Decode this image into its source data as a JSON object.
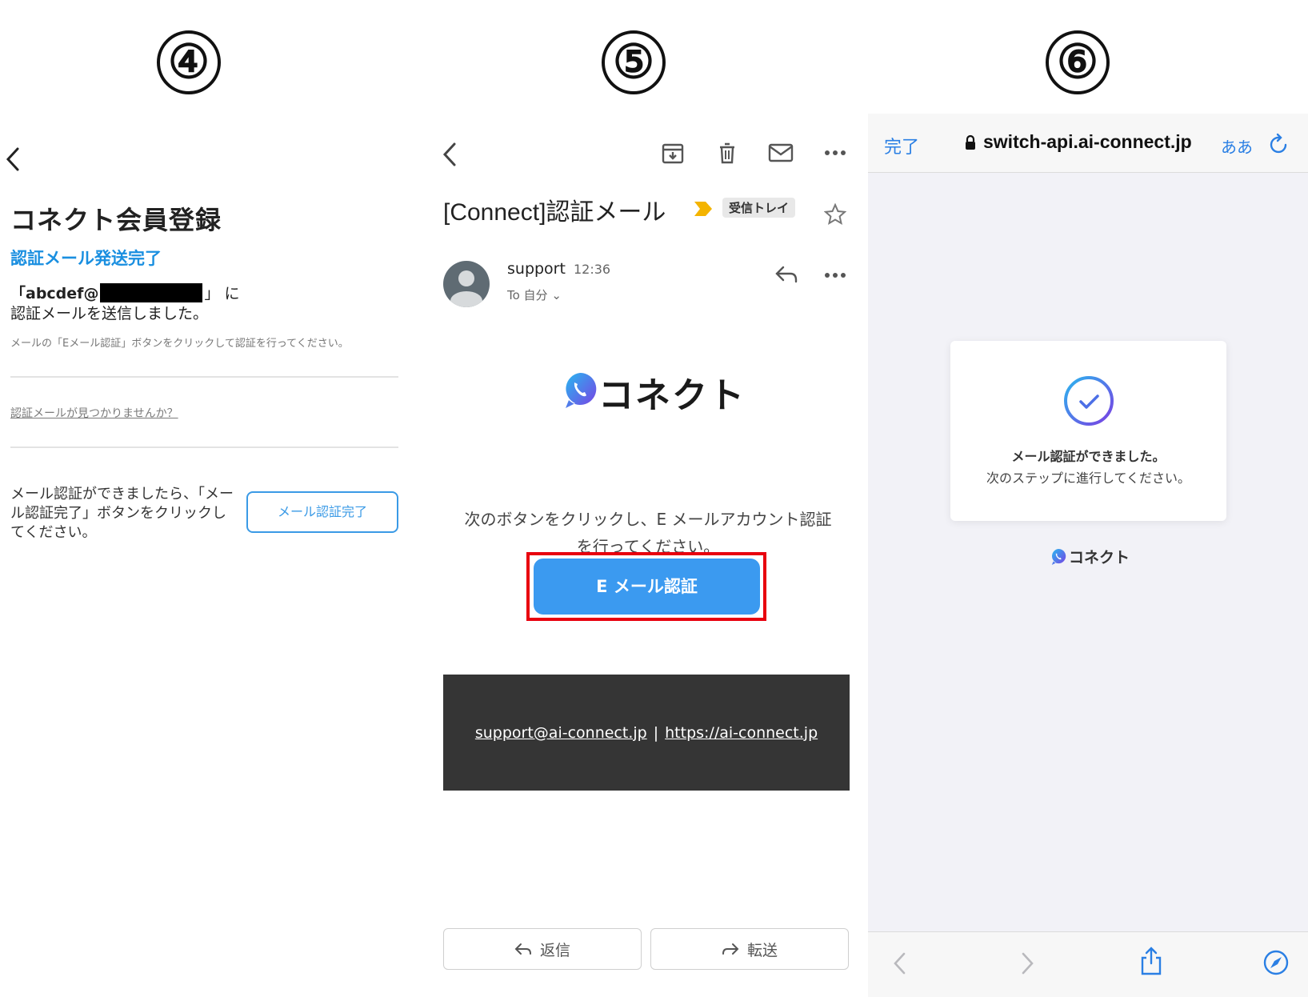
{
  "steps": [
    "④",
    "⑤",
    "⑥"
  ],
  "panel4": {
    "title": "コネクト会員登録",
    "subtitle": "認証メール発送完了",
    "email_prefix": "「abcdef@",
    "email_suffix": "」 に",
    "sent_text": "認証メールを送信しました。",
    "note": "メールの「Eメール認証」ボタンをクリックして認証を行ってください。",
    "not_found_link": "認証メールが見つかりませんか？",
    "instruction": "メール認証ができましたら、「メール認証完了」ボタンをクリックしてください。",
    "complete_button": "メール認証完了"
  },
  "panel5": {
    "subject": "[Connect]認証メール",
    "inbox_label": "受信トレイ",
    "sender": "support",
    "time": "12:36",
    "to": "To 自分 ⌄",
    "brand": "コネクト",
    "body_text": "次のボタンをクリックし、E メールアカウント認証を行ってください。",
    "verify_button": "E メール認証",
    "footer_email": "support@ai-connect.jp",
    "footer_sep": "|",
    "footer_url": "https://ai-connect.jp",
    "reply_button": "返信",
    "forward_button": "転送"
  },
  "panel6": {
    "done": "完了",
    "url": "switch-api.ai-connect.jp",
    "text_size": "ああ",
    "success_title": "メール認証ができました。",
    "success_sub": "次のステップに進行してください。",
    "brand": "コネクト"
  },
  "colors": {
    "accent_blue": "#3b9af0",
    "link_blue": "#1a8fe0",
    "safari_blue": "#2a7fe4",
    "highlight_red": "#e8000e",
    "footer_dark": "#353535"
  }
}
